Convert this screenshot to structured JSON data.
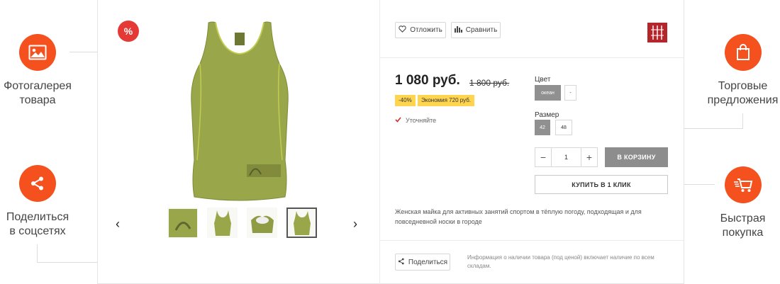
{
  "features": {
    "gallery": {
      "icon": "image-icon",
      "label_line1": "Фотогалерея",
      "label_line2": "товара"
    },
    "share": {
      "icon": "share-icon",
      "label_line1": "Поделиться",
      "label_line2": "в соцсетях"
    },
    "offers": {
      "icon": "shopping-bag-icon",
      "label_line1": "Торговые",
      "label_line2": "предложения"
    },
    "quick_buy": {
      "icon": "fast-cart-icon",
      "label_line1": "Быстрая",
      "label_line2": "покупка"
    }
  },
  "product": {
    "discount_badge": "%",
    "thumbnails": [
      "thumb-print-closeup",
      "thumb-tank-front",
      "thumb-tank-angled",
      "thumb-tank-active"
    ],
    "active_thumb_index": 3,
    "defer_label": "Отложить",
    "compare_label": "Сравнить",
    "price": "1 080 руб.",
    "old_price": "1 800 руб.",
    "discount_tag": "-40%",
    "economy_tag": "Экономия 720 руб.",
    "stock_status": "Уточняйте",
    "color_title": "Цвет",
    "color_options": [
      "океан",
      "-"
    ],
    "size_title": "Размер",
    "size_options": [
      "42",
      "48"
    ],
    "quantity": "1",
    "qty_minus": "−",
    "qty_plus": "+",
    "add_to_cart": "В КОРЗИНУ",
    "buy_one_click": "КУПИТЬ В 1 КЛИК",
    "description": "Женская майка для активных занятий спортом в тёплую погоду, подходящая и для повседневной носки в городе",
    "share_label": "Поделиться",
    "availability_note": "Информация о наличии товара (под ценой) включает наличие по всем складам."
  },
  "colors": {
    "accent": "#f4511e",
    "badge_red": "#e53935",
    "tag_yellow": "#ffd54f",
    "selected_chip": "#909090",
    "cart_button": "#8d8d8d",
    "product_green": "#9aa64a",
    "brand_logo": "#b3262c"
  }
}
